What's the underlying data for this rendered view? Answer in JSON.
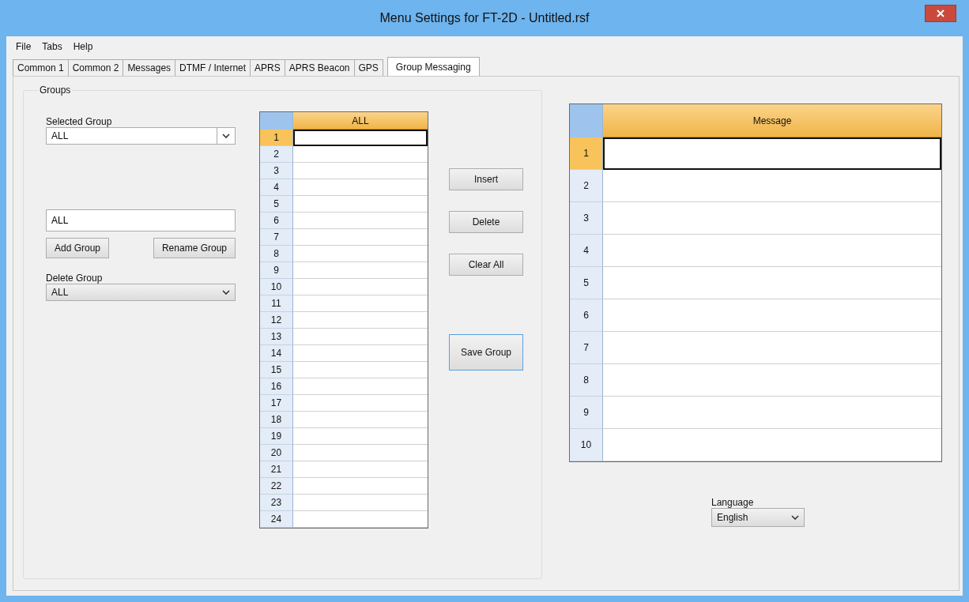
{
  "window": {
    "title": "Menu Settings for FT-2D - Untitled.rsf"
  },
  "menu": [
    "File",
    "Tabs",
    "Help"
  ],
  "tabs": [
    {
      "label": "Common 1",
      "selected": false
    },
    {
      "label": "Common 2",
      "selected": false
    },
    {
      "label": "Messages",
      "selected": false
    },
    {
      "label": "DTMF / Internet",
      "selected": false
    },
    {
      "label": "APRS",
      "selected": false
    },
    {
      "label": "APRS Beacon",
      "selected": false
    },
    {
      "label": "GPS",
      "selected": false
    },
    {
      "label": "Group Messaging",
      "selected": true
    }
  ],
  "groups": {
    "title": "Groups",
    "selected_group": {
      "label": "Selected Group",
      "value": "ALL"
    },
    "name_field": {
      "value": "ALL"
    },
    "add_button": "Add Group",
    "rename_button": "Rename Group",
    "delete_group": {
      "label": "Delete Group",
      "value": "ALL"
    }
  },
  "group_table": {
    "column": "ALL",
    "rows": [
      {
        "number": "1",
        "selected": true
      },
      {
        "number": "2",
        "selected": false
      },
      {
        "number": "3",
        "selected": false
      },
      {
        "number": "4",
        "selected": false
      },
      {
        "number": "5",
        "selected": false
      },
      {
        "number": "6",
        "selected": false
      },
      {
        "number": "7",
        "selected": false
      },
      {
        "number": "8",
        "selected": false
      },
      {
        "number": "9",
        "selected": false
      },
      {
        "number": "10",
        "selected": false
      },
      {
        "number": "11",
        "selected": false
      },
      {
        "number": "12",
        "selected": false
      },
      {
        "number": "13",
        "selected": false
      },
      {
        "number": "14",
        "selected": false
      },
      {
        "number": "15",
        "selected": false
      },
      {
        "number": "16",
        "selected": false
      },
      {
        "number": "17",
        "selected": false
      },
      {
        "number": "18",
        "selected": false
      },
      {
        "number": "19",
        "selected": false
      },
      {
        "number": "20",
        "selected": false
      },
      {
        "number": "21",
        "selected": false
      },
      {
        "number": "22",
        "selected": false
      },
      {
        "number": "23",
        "selected": false
      },
      {
        "number": "24",
        "selected": false
      }
    ]
  },
  "actions": [
    "Insert",
    "Delete",
    "Clear All"
  ],
  "save_button": "Save Group",
  "message_table": {
    "column": "Message",
    "rows": [
      {
        "number": "1",
        "selected": true
      },
      {
        "number": "2",
        "selected": false
      },
      {
        "number": "3",
        "selected": false
      },
      {
        "number": "4",
        "selected": false
      },
      {
        "number": "5",
        "selected": false
      },
      {
        "number": "6",
        "selected": false
      },
      {
        "number": "7",
        "selected": false
      },
      {
        "number": "8",
        "selected": false
      },
      {
        "number": "9",
        "selected": false
      },
      {
        "number": "10",
        "selected": false
      }
    ]
  },
  "language": {
    "label": "Language",
    "value": "English"
  }
}
